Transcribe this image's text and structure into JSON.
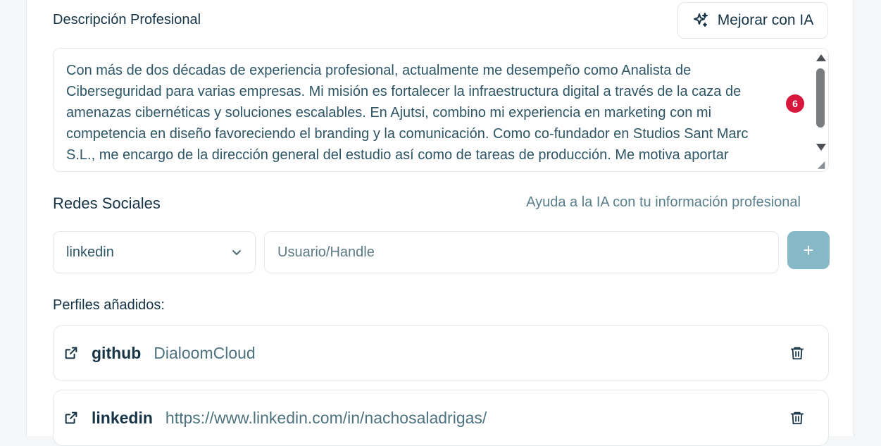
{
  "description": {
    "title": "Descripción Profesional",
    "improve_button": "Mejorar con IA",
    "text": "Con más de dos décadas de experiencia profesional, actualmente me desempeño como Analista de\nCiberseguridad para varias empresas. Mi misión es fortalecer la infraestructura digital a través de la caza de\namenazas cibernéticas y soluciones escalables. En Ajutsi, combino mi experiencia en marketing con mi\ncompetencia en diseño favoreciendo el branding y la comunicación. Como co-fundador en Studios Sant Marc\nS.L., me encargo de la dirección general del estudio así como de tareas de producción. Me motiva aportar",
    "error_count": "6"
  },
  "social": {
    "title": "Redes Sociales",
    "hint": "Ayuda a la IA con tu información profesional",
    "network_selected": "linkedin",
    "handle_placeholder": "Usuario/Handle",
    "add_label": "+"
  },
  "profiles": {
    "title": "Perfiles añadidos:",
    "items": [
      {
        "network": "github",
        "value": "DialoomCloud"
      },
      {
        "network": "linkedin",
        "value": "https://www.linkedin.com/in/nachosaladrigas/"
      }
    ]
  },
  "colors": {
    "accent": "#86b8c8",
    "badge": "#d7173c",
    "text": "#173447"
  }
}
